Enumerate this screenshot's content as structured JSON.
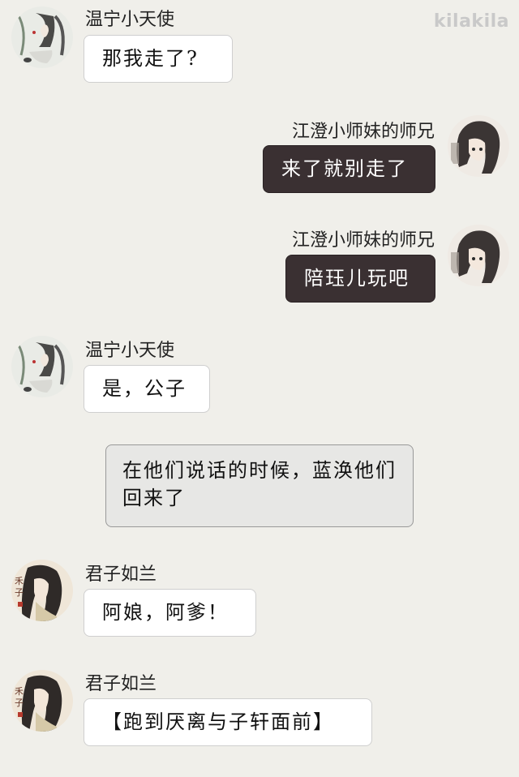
{
  "watermark": "kilakila",
  "messages": [
    {
      "side": "left",
      "name": "温宁小天使",
      "text": "那我走了?",
      "avatar_icon": "ink-portrait-with-rabbit"
    },
    {
      "side": "right",
      "name": "江澄小师妹的师兄",
      "text": "来了就别走了",
      "avatar_icon": "portrait-dark-hair"
    },
    {
      "side": "right",
      "name": "江澄小师妹的师兄",
      "text": "陪珏儿玩吧",
      "avatar_icon": "portrait-dark-hair"
    },
    {
      "side": "left",
      "name": "温宁小天使",
      "text": "是，公子",
      "avatar_icon": "ink-portrait-with-rabbit"
    },
    {
      "side": "narration",
      "text": "在他们说话的时候，蓝涣他们回来了"
    },
    {
      "side": "left",
      "name": "君子如兰",
      "text": "阿娘，阿爹！",
      "avatar_icon": "portrait-long-hair-calligraphy"
    },
    {
      "side": "left",
      "name": "君子如兰",
      "text": "【跑到厌离与子轩面前】",
      "avatar_icon": "portrait-long-hair-calligraphy"
    }
  ]
}
